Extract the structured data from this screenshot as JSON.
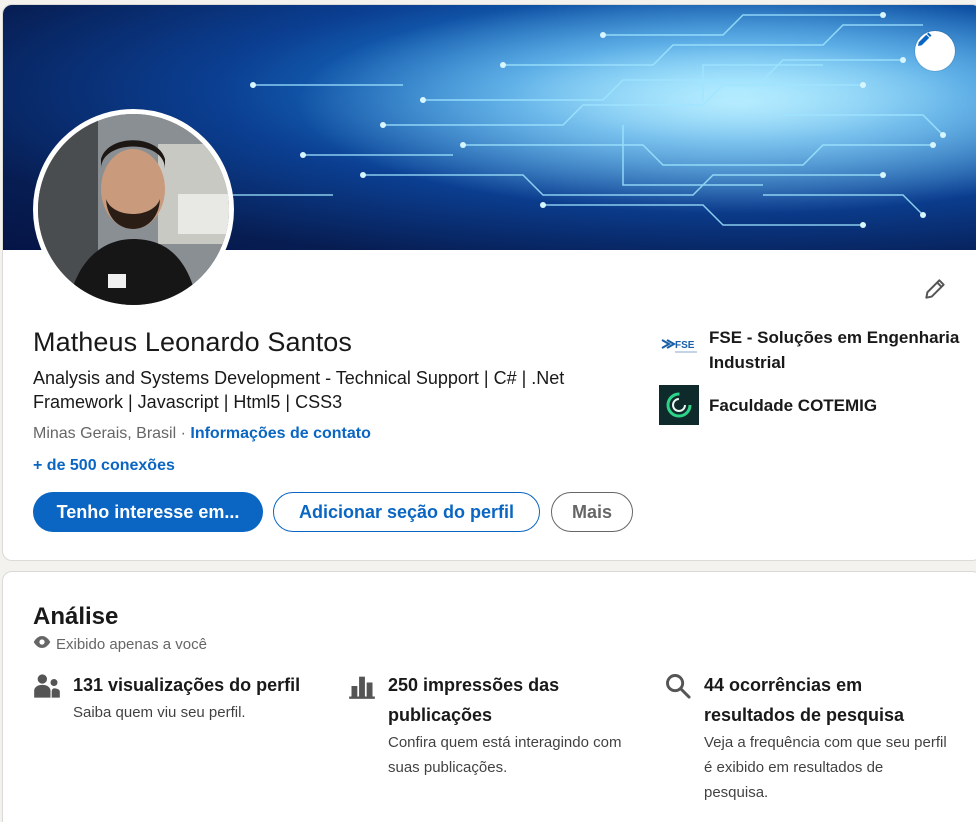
{
  "profile": {
    "name": "Matheus Leonardo Santos",
    "headline": "Analysis and Systems Development - Technical Support | C# | .Net Framework | Javascript | Html5 | CSS3",
    "location": "Minas Gerais, Brasil",
    "separator": " · ",
    "contact_link": "Informações de contato",
    "connections": "+ de 500 conexões"
  },
  "actions": {
    "primary": "Tenho interesse em...",
    "add_section": "Adicionar seção do perfil",
    "more": "Mais"
  },
  "organizations": [
    {
      "name": "FSE - Soluções em Engenharia Industrial",
      "logo_text": "FSE"
    },
    {
      "name": "Faculdade COTEMIG"
    }
  ],
  "analytics": {
    "title": "Análise",
    "subtitle": "Exibido apenas a você",
    "metrics": [
      {
        "icon": "people-icon",
        "title": "131 visualizações do perfil",
        "desc": "Saiba quem viu seu perfil."
      },
      {
        "icon": "bar-chart-icon",
        "title": "250 impressões das publicações",
        "desc": "Confira quem está interagindo com suas publicações."
      },
      {
        "icon": "search-icon",
        "title": "44 ocorrências em resultados de pesquisa",
        "desc": "Veja a frequência com que seu perfil é exibido em resultados de pesquisa."
      }
    ]
  },
  "colors": {
    "brand": "#0a66c2",
    "muted": "#666666",
    "banner_dark": "#071d52",
    "banner_light": "#6fd2ff"
  }
}
